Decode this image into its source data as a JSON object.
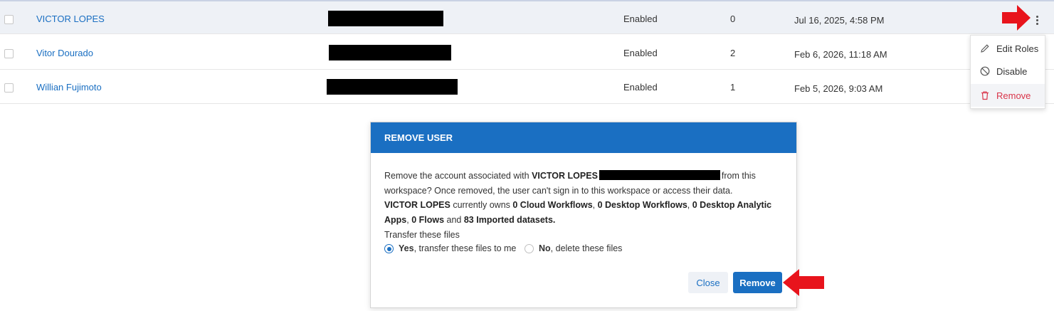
{
  "rows": [
    {
      "name": "VICTOR LOPES",
      "status": "Enabled",
      "roles": "0",
      "date": "Jul 16, 2025, 4:58 PM"
    },
    {
      "name": "Vitor Dourado",
      "status": "Enabled",
      "roles": "2",
      "date": "Feb 6, 2026, 11:18 AM"
    },
    {
      "name": "Willian Fujimoto",
      "status": "Enabled",
      "roles": "1",
      "date": "Feb 5, 2026, 9:03 AM"
    }
  ],
  "menu": {
    "edit_roles": "Edit Roles",
    "disable": "Disable",
    "remove": "Remove"
  },
  "modal": {
    "title": "REMOVE USER",
    "p1_prefix": "Remove the account associated with ",
    "p1_name": "VICTOR LOPES",
    "p1_suffix": "from this workspace? Once removed, the user can't sign in to this workspace or access their data.",
    "owns_name": "VICTOR LOPES",
    "owns_text": " currently owns ",
    "cloud": "0 Cloud Workflows",
    "sep1": ", ",
    "desktop": "0 Desktop Workflows",
    "sep2": ", ",
    "analytic": "0 Desktop Analytic Apps",
    "sep3": ", ",
    "flows": "0 Flows",
    "and": " and ",
    "imported": "83 Imported datasets.",
    "transfer_label": "Transfer these files",
    "yes_bold": "Yes",
    "yes_rest": ", transfer these files to me",
    "no_bold": "No",
    "no_rest": ", delete these files",
    "close_label": "Close",
    "remove_label": "Remove"
  },
  "colors": {
    "accent": "#1a6fc2",
    "danger": "#d9354a",
    "annotation": "#e8141c"
  }
}
